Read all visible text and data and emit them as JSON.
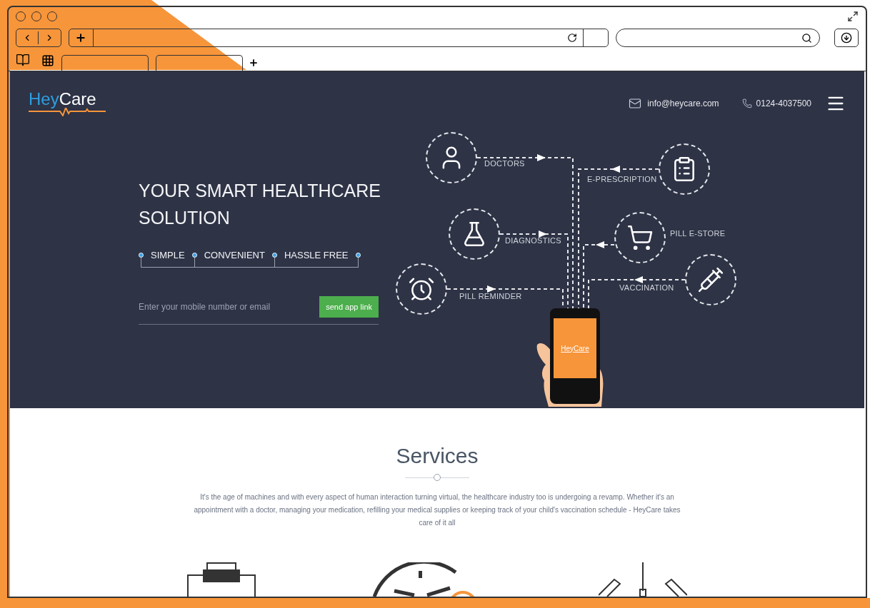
{
  "browser": {
    "tabs": [
      {
        "selected": false
      },
      {
        "selected": false
      }
    ]
  },
  "hero": {
    "logo": {
      "part_1": "Hey",
      "part_2": "Care"
    },
    "email": "info@heycare.com",
    "phone": "0124-4037500",
    "headline": "YOUR SMART HEALTHCARE SOLUTION",
    "features": [
      "SIMPLE",
      "CONVENIENT",
      "HASSLE FREE"
    ],
    "signup": {
      "placeholder": "Enter your mobile number or email",
      "button": "send app link"
    },
    "diagram": {
      "nodes": [
        {
          "label": "DOCTORS"
        },
        {
          "label": "E-PRESCRIPTION"
        },
        {
          "label": "DIAGNOSTICS"
        },
        {
          "label": "PILL E-STORE"
        },
        {
          "label": "PILL REMINDER"
        },
        {
          "label": "VACCINATION"
        }
      ],
      "phone_logo": {
        "part_1": "Hey",
        "part_2": "Care"
      }
    }
  },
  "services": {
    "title": "Services",
    "description": "It's the age of machines and with every aspect of human interaction turning virtual, the healthcare industry too is undergoing a revamp. Whether it's an appointment with a doctor, managing your medication, refilling your medical supplies or keeping track of your child's vaccination schedule - HeyCare takes care of it all"
  }
}
